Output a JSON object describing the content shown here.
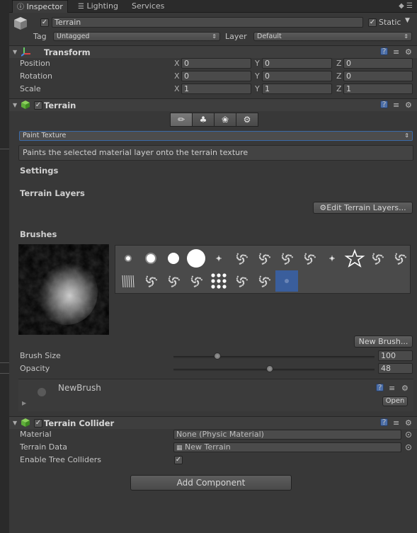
{
  "tabs": [
    {
      "label": "Inspector",
      "icon": "info-icon",
      "active": true
    },
    {
      "label": "Lighting",
      "icon": "lighting-icon",
      "active": false
    },
    {
      "label": "Services",
      "active": false
    }
  ],
  "header": {
    "active_checked": true,
    "object_name": "Terrain",
    "static_label": "Static",
    "static_checked": true,
    "tag_label": "Tag",
    "tag_value": "Untagged",
    "layer_label": "Layer",
    "layer_value": "Default"
  },
  "transform": {
    "title": "Transform",
    "rows": [
      {
        "label": "Position",
        "x": "0",
        "y": "0",
        "z": "0"
      },
      {
        "label": "Rotation",
        "x": "0",
        "y": "0",
        "z": "0"
      },
      {
        "label": "Scale",
        "x": "1",
        "y": "1",
        "z": "1"
      }
    ],
    "axis_x": "X",
    "axis_y": "Y",
    "axis_z": "Z"
  },
  "terrain": {
    "title": "Terrain",
    "enabled": true,
    "tools": [
      "paint-brush-icon",
      "tree-icon",
      "detail-icon",
      "gear-icon"
    ],
    "selected_tool": 0,
    "mode": "Paint Texture",
    "help_text": "Paints the selected material layer onto the terrain texture",
    "settings_label": "Settings",
    "layers_label": "Terrain Layers",
    "edit_layers_button": "Edit Terrain Layers...",
    "brushes_label": "Brushes",
    "new_brush_button": "New Brush...",
    "brush_size_label": "Brush Size",
    "brush_size_value": "100",
    "brush_size_fraction": 0.22,
    "opacity_label": "Opacity",
    "opacity_value": "48",
    "opacity_fraction": 0.48,
    "brush_name": "NewBrush",
    "open_button": "Open",
    "selected_brush_index": 22
  },
  "collider": {
    "title": "Terrain Collider",
    "enabled": true,
    "material_label": "Material",
    "material_value": "None (Physic Material)",
    "terrain_data_label": "Terrain Data",
    "terrain_data_value": "New Terrain",
    "tree_colliders_label": "Enable Tree Colliders",
    "tree_colliders_checked": true
  },
  "add_component_button": "Add Component",
  "colors": {
    "background": "#383838",
    "selection": "#3a5e9c",
    "terrain_icon": "#5fae3a"
  }
}
